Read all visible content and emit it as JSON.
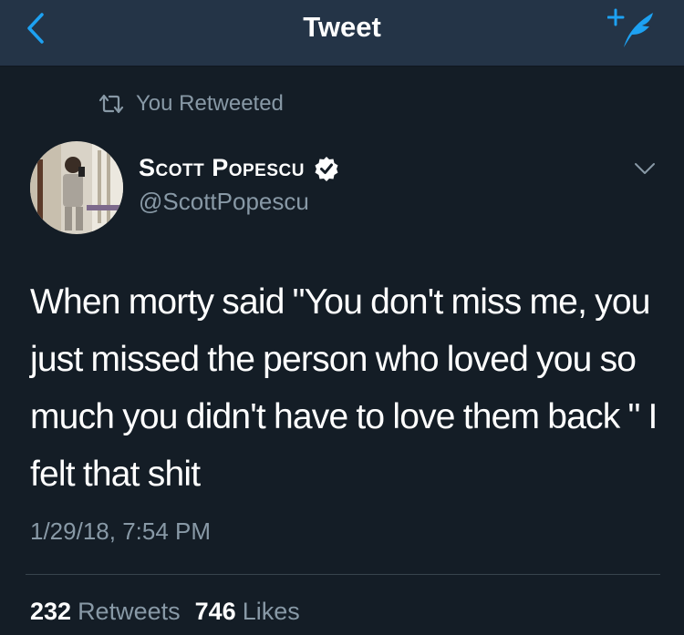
{
  "colors": {
    "background": "#141d26",
    "navbar": "#243447",
    "accent": "#1da1f2",
    "secondary_text": "#8899a6",
    "divider": "#38444d"
  },
  "navbar": {
    "title": "Tweet",
    "back_icon": "chevron-left-icon",
    "compose_icon": "compose-tweet-icon"
  },
  "retweet_context": {
    "icon": "retweet-icon",
    "label": "You Retweeted"
  },
  "tweet": {
    "author": {
      "name": "Scott Popescu",
      "handle": "@ScottPopescu",
      "verified": true,
      "verified_icon": "verified-badge-icon"
    },
    "menu_icon": "chevron-down-icon",
    "text": "When morty said \"You don't miss me, you just missed the person who loved you so much you didn't have to love them back \" I felt that shit",
    "timestamp": "1/29/18, 7:54 PM",
    "stats": {
      "retweets_count": "232",
      "retweets_label": "Retweets",
      "likes_count": "746",
      "likes_label": "Likes"
    }
  }
}
